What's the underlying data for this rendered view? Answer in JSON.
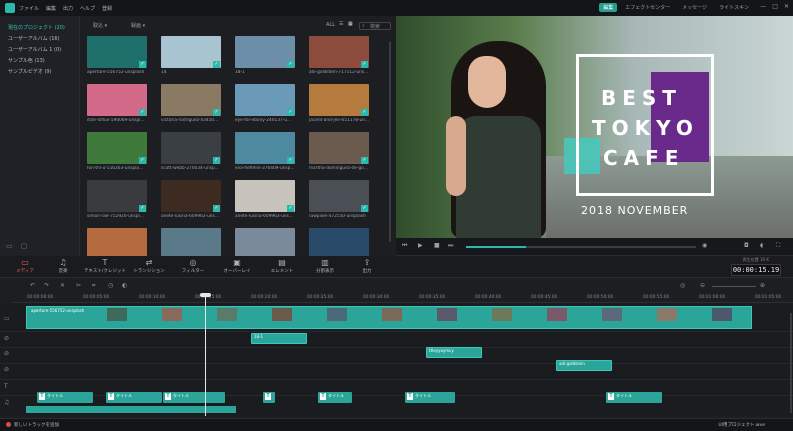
{
  "menubar": {
    "items": [
      "ファイル",
      "編集",
      "出力",
      "ヘルプ",
      "登録"
    ],
    "tabs": [
      {
        "label": "編集",
        "active": true
      },
      {
        "label": "エフェクトセンター",
        "active": false
      },
      {
        "label": "メッセージ",
        "active": false
      },
      {
        "label": "ライトスキン",
        "active": false
      }
    ],
    "window_buttons": [
      "—",
      "□",
      "✕"
    ]
  },
  "sidebar": {
    "items": [
      {
        "label": "現在のプロジェクト (20)",
        "selected": true
      },
      {
        "label": "ユーザーアルバム (16)",
        "selected": false
      },
      {
        "label": "ユーザーアルバム 1 (0)",
        "selected": false
      },
      {
        "label": "サンプル色 (13)",
        "selected": false
      },
      {
        "label": "サンプルビデオ (9)",
        "selected": false
      }
    ]
  },
  "media": {
    "import_label": "取込",
    "record_label": "録画",
    "filter_label": "ALL",
    "search_placeholder": "検索",
    "items": [
      {
        "label": "aperture-556752-unsplash",
        "color": "#1f6f6a"
      },
      {
        "label": "14",
        "color": "#a8c4d0"
      },
      {
        "label": "18-1",
        "color": "#6d8ea8"
      },
      {
        "label": "adi-goldstein-717512-uns...",
        "color": "#8b4b3d"
      },
      {
        "label": "itsle-loflux-590069-unspl...",
        "color": "#d46a8a"
      },
      {
        "label": "victoria-rodriguez-43450...",
        "color": "#8b7a63"
      },
      {
        "label": "eye-for-ebony-240137-u...",
        "color": "#6b9ab8"
      },
      {
        "label": "jacent-and-jen-651178-un...",
        "color": "#b47a3e"
      },
      {
        "label": "fon-thi-u-516263-unspla...",
        "color": "#3f7a3c"
      },
      {
        "label": "scott-webb-270034-unsp...",
        "color": "#3a3f44"
      },
      {
        "label": "eva-heffelin-376409-unsp...",
        "color": "#4d8aa0"
      },
      {
        "label": "martha-dominguez-de-go...",
        "color": "#6b5b4f"
      },
      {
        "label": "simon-rae-752920-unspl...",
        "color": "#3a3b3e"
      },
      {
        "label": "anete-lusina-609963-uns...",
        "color": "#3d2b22"
      },
      {
        "label": "anete-lusina-609963-uns...",
        "color": "#c9c4bb"
      },
      {
        "label": "rawpixel-472550-unsplash",
        "color": "#4a4e55"
      },
      {
        "label": "",
        "color": "#b56b3d"
      },
      {
        "label": "",
        "color": "#5a7a8a"
      },
      {
        "label": "",
        "color": "#7a8a9a"
      },
      {
        "label": "",
        "color": "#2a4a6a"
      }
    ]
  },
  "preview": {
    "title_lines": [
      "BEST",
      "TOKYO",
      "CAFE"
    ],
    "date_text": "2018 NOVEMBER",
    "progress": 0.26
  },
  "tools": [
    {
      "label": "メディア",
      "icon": "folder-icon",
      "active": true
    },
    {
      "label": "音楽",
      "icon": "music-icon",
      "active": false
    },
    {
      "label": "テキスト/クレジット",
      "icon": "text-icon",
      "active": false
    },
    {
      "label": "トランジション",
      "icon": "transition-icon",
      "active": false
    },
    {
      "label": "フィルター",
      "icon": "filter-icon",
      "active": false
    },
    {
      "label": "オーバーレイ",
      "icon": "overlay-icon",
      "active": false
    },
    {
      "label": "エレメント",
      "icon": "element-icon",
      "active": false
    },
    {
      "label": "分割表示",
      "icon": "split-screen-icon",
      "active": false
    },
    {
      "label": "出力",
      "icon": "export-icon",
      "active": false
    }
  ],
  "timecode": {
    "label": "再生位置 10 K",
    "value": "00:00:15.19"
  },
  "ruler": [
    "00:00:00:00",
    "00:00:05:00",
    "00:00:10:00",
    "00:00:15:00",
    "00:00:20:00",
    "00:00:25:00",
    "00:00:30:00",
    "00:00:35:00",
    "00:00:40:00",
    "00:00:45:00",
    "00:00:50:00",
    "00:00:55:00",
    "00:01:00:00",
    "00:01:05:00"
  ],
  "timeline": {
    "video_clip_label": "aperture-556752-unsplash",
    "overlay_clip_1": "18-1",
    "overlay_clip_2": "ttleyyaymcy",
    "overlay_clip_3": "adi-goldstein",
    "title_clip": "タイトル"
  },
  "status": {
    "left": "新しいトラックを追加",
    "right": "UI用プロジェクト.wve"
  }
}
